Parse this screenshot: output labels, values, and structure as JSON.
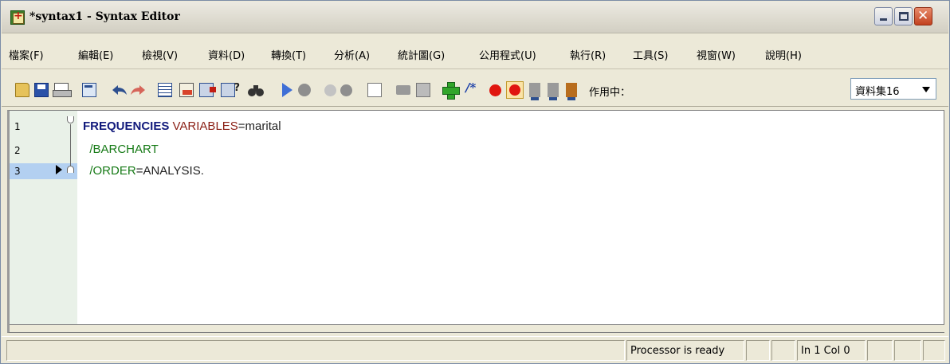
{
  "window": {
    "title": "*syntax1 - Syntax Editor"
  },
  "menu": {
    "items": [
      "檔案(F)",
      "編輯(E)",
      "檢視(V)",
      "資料(D)",
      "轉換(T)",
      "分析(A)",
      "統計圖(G)",
      "公用程式(U)",
      "執行(R)",
      "工具(S)",
      "視窗(W)",
      "說明(H)"
    ]
  },
  "toolbar": {
    "icons": [
      "open-icon",
      "save-icon",
      "print-icon",
      "recall-dialog-icon",
      "undo-icon",
      "redo-icon",
      "go-to-data-icon",
      "go-to-variable-icon",
      "insert-cases-icon",
      "variables-icon",
      "find-icon",
      "run-selection-icon",
      "stop-icon",
      "paste-icon",
      "step-icon",
      "wrap-icon",
      "indent-icon",
      "format-icon",
      "add-icon",
      "comment-icon",
      "breakpoint-icon",
      "clear-breakpoints-icon",
      "bookmark-icon",
      "bookmark-prev-icon",
      "bookmark-next-icon"
    ],
    "active_label": "作用中：",
    "dataset": "資料集16"
  },
  "editor": {
    "line_numbers": [
      "1",
      "2",
      "3"
    ],
    "lines": [
      {
        "cmd": "FREQUENCIES",
        "sub": "VARIABLES",
        "rest": "=marital"
      },
      {
        "slash": "/BARCHART"
      },
      {
        "slash": "/ORDER",
        "rest": "=ANALYSIS."
      }
    ],
    "current_line": 3
  },
  "status": {
    "processor": "Processor is ready",
    "position": "In 1 Col 0"
  },
  "colors": {
    "command": "#121a7c",
    "subcommand": "#8a1e14",
    "slash_subcommand": "#167a16",
    "gutter": "#e9f1e8",
    "current_line": "#b3d0f1"
  }
}
